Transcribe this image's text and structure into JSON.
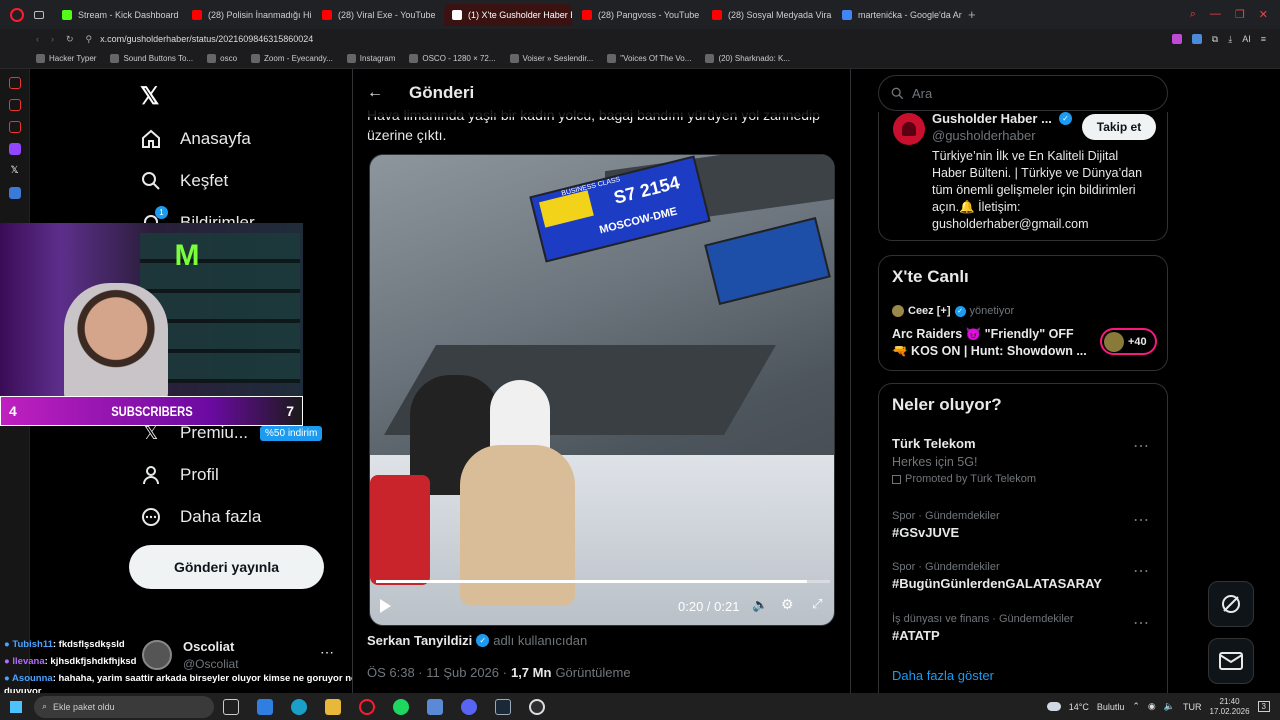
{
  "tabs": [
    {
      "label": "Stream - Kick Dashboard",
      "color": "#53fc18"
    },
    {
      "label": "(28) Polisin İnanmadığı Hi",
      "color": "#ff0000"
    },
    {
      "label": "(28) Viral Exe - YouTube",
      "color": "#ff0000"
    },
    {
      "label": "(1) X'te Gusholder Haber E",
      "color": "#ffffff",
      "active": true
    },
    {
      "label": "(28) Pangvoss - YouTube",
      "color": "#ff0000"
    },
    {
      "label": "(28) Sosyal Medyada Vira",
      "color": "#ff0000"
    },
    {
      "label": "martenićka - Google'da Ar",
      "color": "#4285f4"
    }
  ],
  "address": "x.com/gusholderhaber/status/2021609846315860024",
  "bookmarks": [
    "Hacker Typer",
    "Sound Buttons To...",
    "osco",
    "Zoom - Eyecandy...",
    "Instagram",
    "OSCO - 1280 × 72...",
    "Voiser » Seslendir...",
    "\"Voices Of The Vo...",
    "(20) Sharknado: K..."
  ],
  "nav": {
    "items": [
      "Anasayfa",
      "Keşfet",
      "Bildirimler",
      "Premiu...",
      "Profil",
      "Daha fazla"
    ],
    "premium_badge": "%50 indirim",
    "notif_count": "1",
    "post_button": "Gönderi yayınla",
    "account_name": "Oscoliat",
    "account_handle": "@Oscoliat"
  },
  "overlay": {
    "left_num": "4",
    "label": "SUBSCRIBERS",
    "right_num": "7"
  },
  "chat": [
    {
      "user": "Tubish11",
      "msg": ": fkdsflşsdkşsld",
      "color": "#4aa3ff"
    },
    {
      "user": "llevana",
      "msg": ": kjhsdkfjshdkfhjksd",
      "color": "#b36bff"
    },
    {
      "user": "Asounna",
      "msg": ": hahaha, yarim saattir arkada birseyler oluyor kimse ne goruyor ne duyuyor",
      "color": "#4aa3ff"
    }
  ],
  "post": {
    "header": "Gönderi",
    "text_line1": "Hava limanında yaşlı bir kadın yolcu, bagaj bandını yürüyen yol zannedip",
    "text_line2": "üzerine çıktı.",
    "video_time": "0:20 / 0:21",
    "video_progress": 0.95,
    "sign_class": "BUSINESS CLASS",
    "sign_flight": "S7 2154",
    "sign_dest": "MOSCOW-DME",
    "author": "Serkan Tanyildizi",
    "author_tag": "adlı kullanıcıdan",
    "time": "ÖS 6:38 · 11 Şub 2026 ·",
    "views": "1,7 Mn",
    "views_label": "Görüntüleme"
  },
  "search_placeholder": "Ara",
  "profile_card": {
    "name": "Gusholder Haber ...",
    "handle": "@gusholderhaber",
    "follow": "Takip et",
    "bio": [
      "Türkiye’nin İlk ve En Kaliteli Dijital",
      "Haber Bülteni. | Türkiye ve Dünya’dan",
      "tüm önemli gelişmeler için bildirimleri",
      "açın.🔔 İletişim:",
      "gusholderhaber@gmail.com"
    ]
  },
  "live": {
    "title": "X'te Canlı",
    "host": "Ceez [+]",
    "host_role": "yönetiyor",
    "line1": "Arc Raiders 😈 \"Friendly\" OFF",
    "line2": "🔫 KOS ON | Hunt: Showdown ...",
    "count": "+40"
  },
  "trends": {
    "title": "Neler oluyor?",
    "items": [
      {
        "meta": "",
        "name": "Türk Telekom",
        "sub": "Herkes için 5G!",
        "promo": "Promoted by Türk Telekom"
      },
      {
        "meta": "Spor · Gündemdekiler",
        "name": "#GSvJUVE"
      },
      {
        "meta": "Spor · Gündemdekiler",
        "name": "#BugünGünlerdenGALATASARAY"
      },
      {
        "meta": "İş dünyası ve finans · Gündemdekiler",
        "name": "#ATATP"
      }
    ],
    "more": "Daha fazla göster"
  },
  "taskbar": {
    "weather": "14°C",
    "weather_label": "Bulutlu",
    "lang": "TUR",
    "clock": "21:40",
    "date": "17.02.2026",
    "notif": "3",
    "search_text": "Ekle paket oldu"
  }
}
